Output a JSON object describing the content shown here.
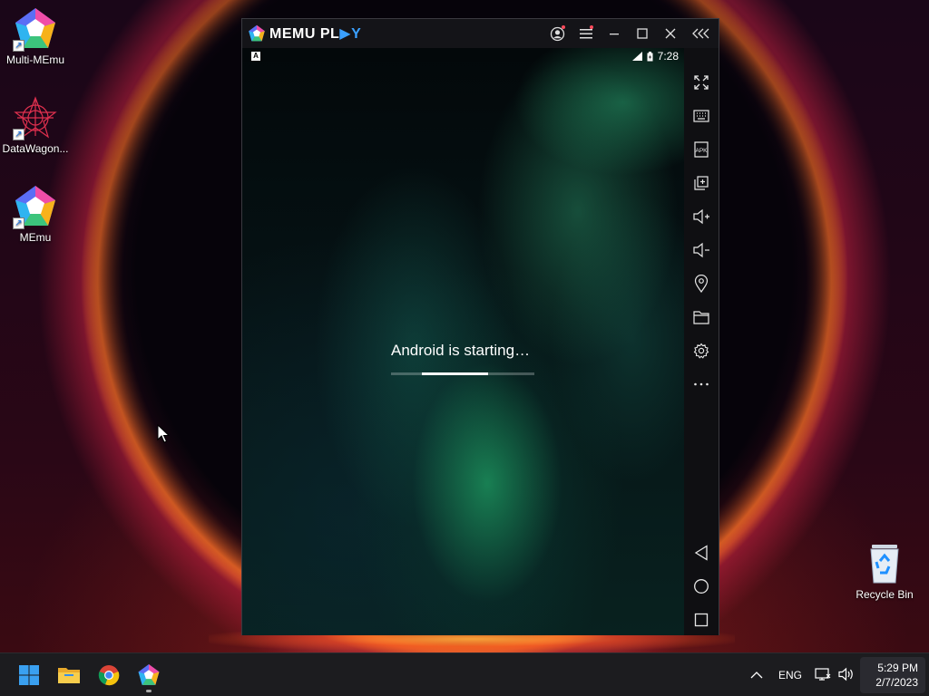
{
  "desktop": {
    "icons": [
      {
        "label": "Multi-MEmu"
      },
      {
        "label": "DataWagon..."
      },
      {
        "label": "MEmu"
      },
      {
        "label": "Recycle Bin"
      }
    ]
  },
  "emulator": {
    "title": "MEMU PLAY",
    "title_part1": "MEMU PL",
    "title_part2": "▶Y",
    "titlebar_buttons": [
      "account-icon",
      "menu-icon",
      "minimize-icon",
      "maximize-icon",
      "close-icon",
      "collapse-toolbar-icon"
    ],
    "status": {
      "left_badge": "A",
      "time": "7:28"
    },
    "boot_message": "Android is starting…",
    "boot_progress": 0.46,
    "toolbar_items": [
      "fullscreen-icon",
      "keyboard-icon",
      "apk-icon",
      "multi-instance-icon",
      "volume-up-icon",
      "volume-down-icon",
      "location-icon",
      "folder-icon",
      "settings-icon",
      "more-icon",
      "back-icon",
      "home-icon",
      "recent-apps-icon"
    ],
    "apk_label": "APK"
  },
  "taskbar": {
    "apps": [
      "start-icon",
      "file-explorer-icon",
      "chrome-icon",
      "memu-icon"
    ],
    "tray": {
      "language": "ENG",
      "time": "5:29 PM",
      "date": "2/7/2023"
    }
  },
  "colors": {
    "memu_accent": "#3aa0ff",
    "notification_dot": "#ff4b5c",
    "taskbar_bg": "#1c1c1f"
  }
}
